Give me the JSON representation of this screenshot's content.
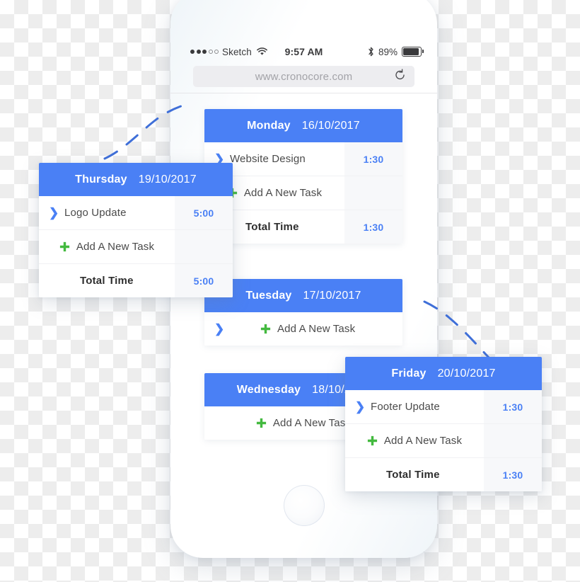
{
  "app": {
    "background": "checkerboard-transparency",
    "accent_blue": "#4a80f5",
    "accent_green": "#43b93f",
    "time_text_color": "#4a80f5"
  },
  "phone": {
    "status_bar": {
      "carrier": "Sketch",
      "time": "9:57 AM",
      "battery_percent": "89%",
      "signal_dots_filled": 3,
      "signal_dots_total": 5,
      "wifi_icon": "wifi-icon",
      "bluetooth_icon": "bluetooth-icon",
      "battery_icon": "battery-icon"
    },
    "browser": {
      "url": "www.cronocore.com",
      "reload_icon": "reload-icon"
    },
    "home_button": "home-button"
  },
  "labels": {
    "add_task": "Add A New Task",
    "total_time": "Total Time",
    "chevron_icon": "chevron-right-icon",
    "plus_icon": "plus-icon"
  },
  "cards": [
    {
      "id": "monday",
      "day": "Monday",
      "date": "16/10/2017",
      "tasks": [
        {
          "name": "Website Design",
          "time": "1:30"
        }
      ],
      "total_time": "1:30",
      "has_total": true
    },
    {
      "id": "tuesday",
      "day": "Tuesday",
      "date": "17/10/2017",
      "tasks": [],
      "total_time": "",
      "has_total": false
    },
    {
      "id": "wednesday",
      "day": "Wednesday",
      "date": "18/10/2017",
      "tasks": [],
      "total_time": "",
      "has_total": false
    },
    {
      "id": "thursday",
      "day": "Thursday",
      "date": "19/10/2017",
      "tasks": [
        {
          "name": "Logo Update",
          "time": "5:00"
        }
      ],
      "total_time": "5:00",
      "has_total": true
    },
    {
      "id": "friday",
      "day": "Friday",
      "date": "20/10/2017",
      "tasks": [
        {
          "name": "Footer Update",
          "time": "1:30"
        }
      ],
      "total_time": "1:30",
      "has_total": true
    }
  ]
}
